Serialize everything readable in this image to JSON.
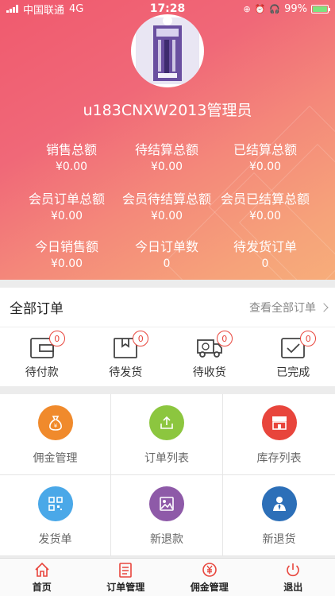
{
  "status_bar": {
    "carrier": "中国联通",
    "network": "4G",
    "time": "17:28",
    "battery": "99%",
    "battery_level": 0.99
  },
  "profile": {
    "username": "u183CNXW2013管理员"
  },
  "stats": [
    {
      "label": "销售总额",
      "value": "¥0.00"
    },
    {
      "label": "待结算总额",
      "value": "¥0.00"
    },
    {
      "label": "已结算总额",
      "value": "¥0.00"
    },
    {
      "label": "会员订单总额",
      "value": "¥0.00"
    },
    {
      "label": "会员待结算总额",
      "value": "¥0.00"
    },
    {
      "label": "会员已结算总额",
      "value": "¥0.00"
    },
    {
      "label": "今日销售额",
      "value": "¥0.00"
    },
    {
      "label": "今日订单数",
      "value": "0"
    },
    {
      "label": "待发货订单",
      "value": "0"
    }
  ],
  "orders": {
    "title": "全部订单",
    "view_all": "查看全部订单",
    "items": [
      {
        "label": "待付款",
        "count": "0",
        "icon": "wallet-icon"
      },
      {
        "label": "待发货",
        "count": "0",
        "icon": "package-icon"
      },
      {
        "label": "待收货",
        "count": "0",
        "icon": "delivery-truck-icon"
      },
      {
        "label": "已完成",
        "count": "0",
        "icon": "check-box-icon"
      }
    ]
  },
  "grid": [
    {
      "label": "佣金管理",
      "icon": "money-bag-icon",
      "color": "#f08a2c"
    },
    {
      "label": "订单列表",
      "icon": "upload-icon",
      "color": "#8cc63f"
    },
    {
      "label": "库存列表",
      "icon": "store-icon",
      "color": "#e8453c"
    },
    {
      "label": "发货单",
      "icon": "qr-code-icon",
      "color": "#4aa8e8"
    },
    {
      "label": "新退款",
      "icon": "image-icon",
      "color": "#8e5aa8"
    },
    {
      "label": "新退货",
      "icon": "user-tie-icon",
      "color": "#2c6fb8"
    }
  ],
  "tabbar": [
    {
      "label": "首页",
      "icon": "home-icon"
    },
    {
      "label": "订单管理",
      "icon": "clipboard-icon"
    },
    {
      "label": "佣金管理",
      "icon": "yen-icon"
    },
    {
      "label": "退出",
      "icon": "power-icon"
    }
  ]
}
